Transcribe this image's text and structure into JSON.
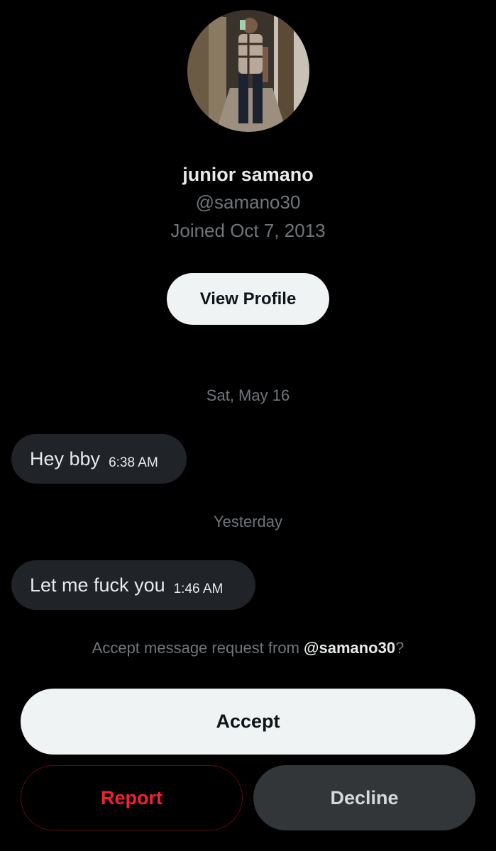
{
  "profile": {
    "display_name": "junior samano",
    "handle": "@samano30",
    "joined": "Joined Oct 7, 2013",
    "view_profile_label": "View Profile",
    "avatar_icon": "profile-photo-mirror-selfie"
  },
  "conversation": {
    "groups": [
      {
        "date_label": "Sat, May 16",
        "messages": [
          {
            "text": "Hey bby",
            "time": "6:38 AM"
          }
        ]
      },
      {
        "date_label": "Yesterday",
        "messages": [
          {
            "text": "Let me fuck you",
            "time": "1:46 AM"
          }
        ]
      }
    ]
  },
  "request": {
    "prefix": "Accept message request from ",
    "handle": "@samano30",
    "suffix": "?"
  },
  "actions": {
    "accept_label": "Accept",
    "report_label": "Report",
    "decline_label": "Decline"
  },
  "colors": {
    "background": "#000000",
    "primary_text": "#e7e9ea",
    "secondary_text": "#71767b",
    "bubble": "#202327",
    "light_button": "#eff3f4",
    "danger": "#f4212e",
    "dark_button": "#333639"
  }
}
